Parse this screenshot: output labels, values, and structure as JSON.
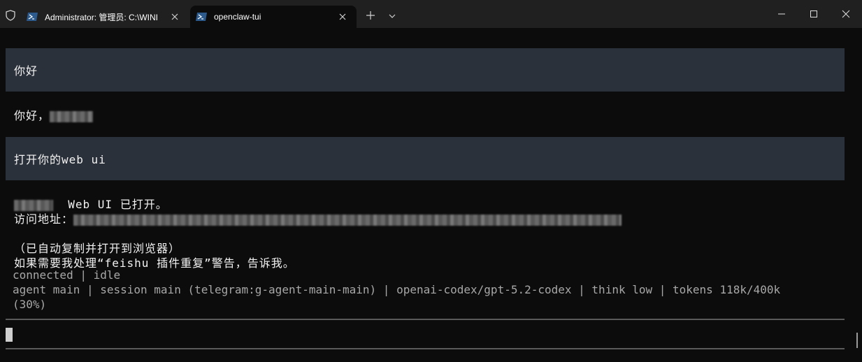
{
  "tabs": [
    {
      "title": "Administrator: 管理员:  C:\\WINI",
      "active": false
    },
    {
      "title": "openclaw-tui",
      "active": true
    }
  ],
  "conversation": {
    "user_msg_1": "你好",
    "reply_1": "你好，",
    "user_msg_2": "打开你的web ui",
    "reply_2_line_1": "Web UI 已打开。",
    "reply_2_addr_label": "访问地址：",
    "reply_2_line_3": "（已自动复制并打开到浏览器）",
    "reply_2_line_4": "如果需要我处理“feishu 插件重复”警告，告诉我。"
  },
  "status": {
    "connection": "connected | idle",
    "session_info": "agent main | session main (telegram:g-agent-main-main) | openai-codex/gpt-5.2-codex | think low | tokens 118k/400k",
    "context_pct": "(30%)"
  },
  "colors": {
    "titlebar": "#202020",
    "terminal_bg": "#0c0c0c",
    "user_msg_bg": "#2b313a",
    "status_text": "#a8a8a8"
  }
}
